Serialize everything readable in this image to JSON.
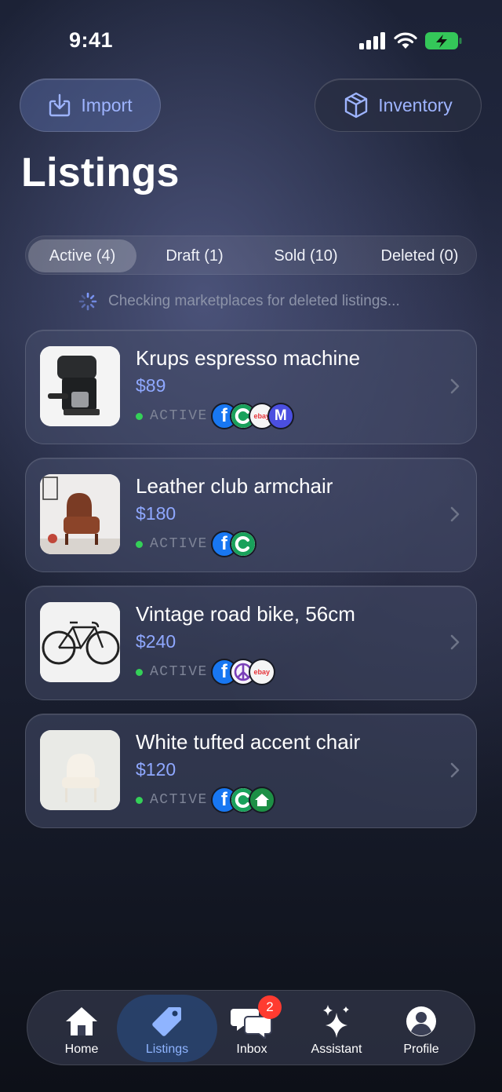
{
  "status_bar": {
    "time": "9:41"
  },
  "header": {
    "import_label": "Import",
    "inventory_label": "Inventory",
    "title": "Listings"
  },
  "tabs": [
    {
      "label": "Active (4)",
      "selected": true
    },
    {
      "label": "Draft (1)",
      "selected": false
    },
    {
      "label": "Sold (10)",
      "selected": false
    },
    {
      "label": "Deleted (0)",
      "selected": false
    }
  ],
  "checking_text": "Checking marketplaces for deleted listings...",
  "listings": [
    {
      "title": "Krups espresso machine",
      "price": "$89",
      "status": "ACTIVE",
      "marketplaces": [
        "facebook-icon",
        "circle-c-icon",
        "ebay-icon",
        "m-icon"
      ]
    },
    {
      "title": "Leather club armchair",
      "price": "$180",
      "status": "ACTIVE",
      "marketplaces": [
        "facebook-icon",
        "circle-c-icon"
      ]
    },
    {
      "title": "Vintage road bike, 56cm",
      "price": "$240",
      "status": "ACTIVE",
      "marketplaces": [
        "facebook-icon",
        "peace-icon",
        "ebay-icon"
      ]
    },
    {
      "title": "White tufted accent chair",
      "price": "$120",
      "status": "ACTIVE",
      "marketplaces": [
        "facebook-icon",
        "circle-c-icon",
        "home-shirt-icon"
      ]
    }
  ],
  "marketplace_labels": {
    "ebay": "ebay",
    "fb": "f",
    "m": "M"
  },
  "nav": {
    "items": [
      {
        "label": "Home"
      },
      {
        "label": "Listings",
        "active": true
      },
      {
        "label": "Inbox",
        "badge": "2"
      },
      {
        "label": "Assistant"
      },
      {
        "label": "Profile"
      }
    ]
  },
  "colors": {
    "accent": "#8fa8ff",
    "active_dot": "#34d058",
    "badge": "#ff3b30",
    "battery": "#34c759"
  }
}
